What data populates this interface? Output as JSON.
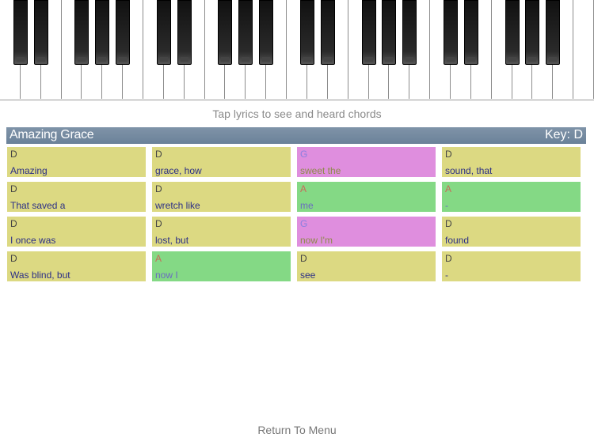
{
  "instruction": "Tap lyrics to see and heard chords",
  "song": {
    "title": "Amazing Grace",
    "key_label": "Key: D"
  },
  "colors": {
    "yellow": "#dcd982",
    "green": "#84d985",
    "pink": "#df8ede",
    "title_bar": "#7389a0"
  },
  "lyrics_grid": [
    [
      {
        "chord": "D",
        "lyric": "Amazing",
        "color": "yellow"
      },
      {
        "chord": "D",
        "lyric": "grace, how",
        "color": "yellow"
      },
      {
        "chord": "G",
        "lyric": "sweet the",
        "color": "pink"
      },
      {
        "chord": "D",
        "lyric": "sound, that",
        "color": "yellow"
      }
    ],
    [
      {
        "chord": "D",
        "lyric": "That saved a",
        "color": "yellow"
      },
      {
        "chord": "D",
        "lyric": "wretch like",
        "color": "yellow"
      },
      {
        "chord": "A",
        "lyric": "me",
        "color": "green"
      },
      {
        "chord": "A",
        "lyric": "-",
        "color": "green"
      }
    ],
    [
      {
        "chord": "D",
        "lyric": "I once was",
        "color": "yellow"
      },
      {
        "chord": "D",
        "lyric": "lost, but",
        "color": "yellow"
      },
      {
        "chord": "G",
        "lyric": "now I'm",
        "color": "pink"
      },
      {
        "chord": "D",
        "lyric": "found",
        "color": "yellow"
      }
    ],
    [
      {
        "chord": "D",
        "lyric": "Was blind, but",
        "color": "yellow"
      },
      {
        "chord": "A",
        "lyric": "now I",
        "color": "green"
      },
      {
        "chord": "D",
        "lyric": "see",
        "color": "yellow"
      },
      {
        "chord": "D",
        "lyric": "-",
        "color": "yellow"
      }
    ]
  ],
  "return_label": "Return To Menu"
}
